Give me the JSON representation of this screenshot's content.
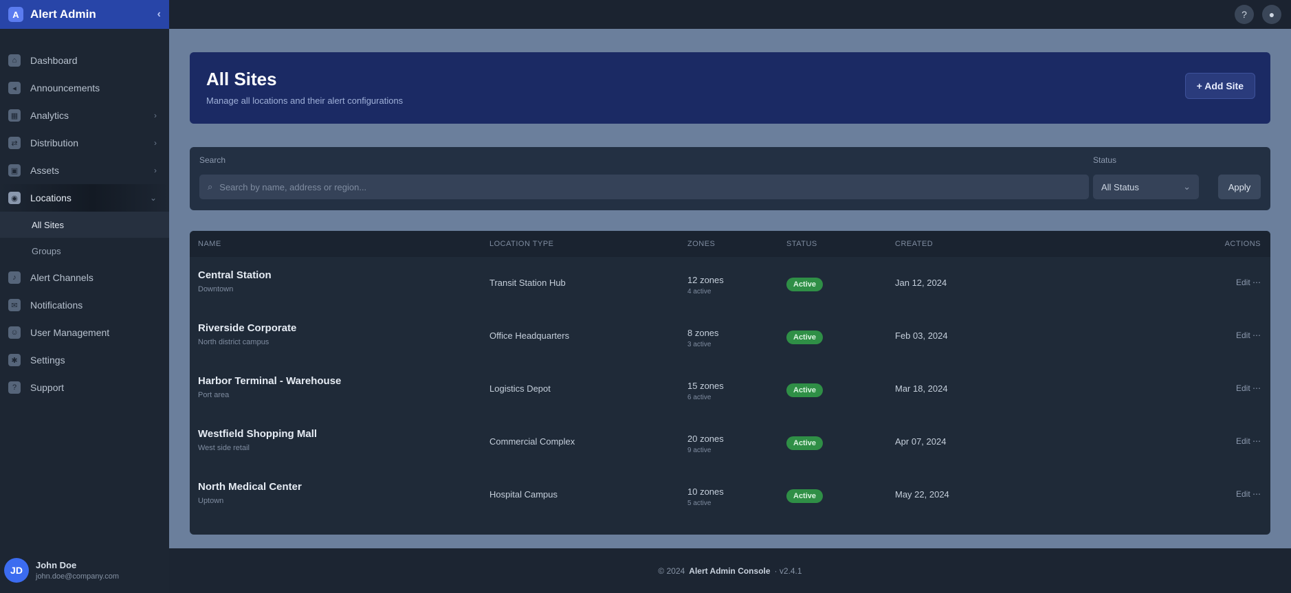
{
  "brand": {
    "name": "Alert Admin",
    "logo_glyph": "A",
    "collapse_glyph": "‹"
  },
  "sidebar": {
    "items": [
      {
        "label": "Dashboard",
        "icon": "home-icon"
      },
      {
        "label": "Announcements",
        "icon": "megaphone-icon"
      },
      {
        "label": "Analytics",
        "icon": "chart-icon",
        "chevron": "›"
      },
      {
        "label": "Distribution",
        "icon": "share-icon",
        "chevron": "›"
      },
      {
        "label": "Assets",
        "icon": "box-icon",
        "chevron": "›"
      },
      {
        "label": "Locations",
        "icon": "map-pin-icon",
        "chevron": "⌄",
        "active": true
      }
    ],
    "sub_items": [
      {
        "label": "All Sites",
        "active": true
      },
      {
        "label": "Groups"
      }
    ],
    "items_bottom": [
      {
        "label": "Alert Channels",
        "icon": "bell-icon"
      },
      {
        "label": "Notifications",
        "icon": "mail-icon"
      },
      {
        "label": "User Management",
        "icon": "users-icon"
      },
      {
        "label": "Settings",
        "icon": "gear-icon"
      },
      {
        "label": "Support",
        "icon": "help-icon"
      }
    ]
  },
  "user": {
    "initials": "JD",
    "name": "John Doe",
    "email": "john.doe@company.com"
  },
  "topbar": {
    "help_glyph": "?",
    "profile_glyph": "●"
  },
  "banner": {
    "title": "All Sites",
    "subtitle": "Manage all locations and their alert configurations",
    "new_button": "+ Add Site"
  },
  "filters": {
    "search_label": "Search",
    "search_placeholder": "Search by name, address or region...",
    "status_label": "Status",
    "status_value": "All Status",
    "apply_label": "Apply"
  },
  "table": {
    "headers": [
      "NAME",
      "LOCATION TYPE",
      "ZONES",
      "STATUS",
      "CREATED",
      "ACTIONS"
    ],
    "rows": [
      {
        "name": "Central Station",
        "sub": "Downtown",
        "location": "Transit Station Hub",
        "zones": "12 zones",
        "zones_sub": "4 active",
        "status": "Active",
        "created": "Jan 12, 2024",
        "actions": "Edit ⋯"
      },
      {
        "name": "Riverside Corporate",
        "sub": "North district campus",
        "location": "Office Headquarters",
        "zones": "8 zones",
        "zones_sub": "3 active",
        "status": "Active",
        "created": "Feb 03, 2024",
        "actions": "Edit ⋯"
      },
      {
        "name": "Harbor Terminal - Warehouse",
        "sub": "Port area",
        "location": "Logistics Depot",
        "zones": "15 zones",
        "zones_sub": "6 active",
        "status": "Active",
        "created": "Mar 18, 2024",
        "actions": "Edit ⋯"
      },
      {
        "name": "Westfield Shopping Mall",
        "sub": "West side retail",
        "location": "Commercial Complex",
        "zones": "20 zones",
        "zones_sub": "9 active",
        "status": "Active",
        "created": "Apr 07, 2024",
        "actions": "Edit ⋯"
      },
      {
        "name": "North Medical Center",
        "sub": "Uptown",
        "location": "Hospital Campus",
        "zones": "10 zones",
        "zones_sub": "5 active",
        "status": "Active",
        "created": "May 22, 2024",
        "actions": "Edit ⋯"
      }
    ]
  },
  "footer": {
    "prefix": "© 2024",
    "brand": "Alert Admin Console",
    "suffix": "· v2.4.1"
  },
  "colors": {
    "brand": "#2845a8",
    "banner": "#1b2a64",
    "status_active": "#2f8f46",
    "workspace": "#6b7f9c"
  }
}
